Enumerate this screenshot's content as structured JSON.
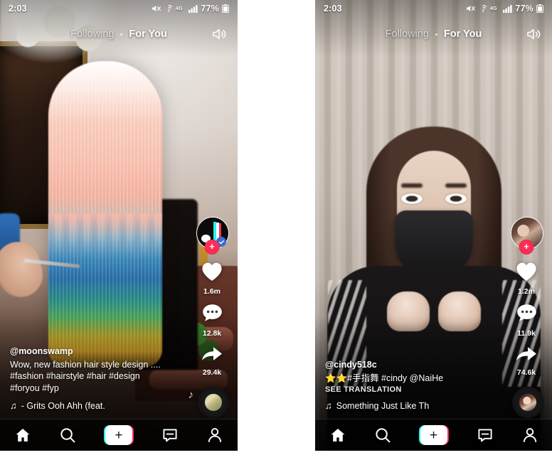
{
  "app": {
    "name": "TikTok"
  },
  "panels": [
    {
      "id": "left",
      "status": {
        "time": "2:03",
        "battery_pct": "77%",
        "icons": [
          "mute-icon",
          "wifi-icon",
          "lte-icon",
          "signal-icon",
          "battery-icon"
        ]
      },
      "topnav": {
        "following": "Following",
        "for_you": "For You",
        "active": "For You",
        "sound_icon": "sound-on-icon"
      },
      "rail": {
        "avatar_type": "tiktok-logo",
        "follow_label": "+",
        "like_count": "1.6m",
        "comment_count": "12.8k",
        "share_count": "29.4k"
      },
      "caption": {
        "username": "@moonswamp",
        "description": "Wow, new fashion hair style design ....",
        "hashtags_line1": "#fashion #hairstyle #hair #design",
        "hashtags_line2": "#foryou #fyp",
        "translation_label": "",
        "music_note": "♫",
        "music_text": "- Grits   Ooh Ahh (feat."
      },
      "bottomnav": {
        "home": "home-icon",
        "discover": "search-icon",
        "create": "+",
        "inbox": "inbox-icon",
        "profile": "profile-icon"
      }
    },
    {
      "id": "right",
      "status": {
        "time": "2:03",
        "battery_pct": "77%",
        "icons": [
          "mute-icon",
          "wifi-icon",
          "lte-icon",
          "signal-icon",
          "battery-icon"
        ]
      },
      "topnav": {
        "following": "Following",
        "for_you": "For You",
        "active": "For You",
        "sound_icon": "sound-on-icon"
      },
      "rail": {
        "avatar_type": "user-photo",
        "follow_label": "+",
        "like_count": "1.2m",
        "comment_count": "11.9k",
        "share_count": "74.6k"
      },
      "caption": {
        "username": "@cindy518c",
        "description": "⭐⭐#手指舞 #cindy @NaiHe",
        "hashtags_line1": "",
        "hashtags_line2": "",
        "translation_label": "SEE TRANSLATION",
        "music_note": "♫",
        "music_text": "Something Just Like Th"
      },
      "bottomnav": {
        "home": "home-icon",
        "discover": "search-icon",
        "create": "+",
        "inbox": "inbox-icon",
        "profile": "profile-icon"
      }
    }
  ],
  "colors": {
    "accent_red": "#fe2c55",
    "accent_cyan": "#25f4ee",
    "text_white": "#ffffff",
    "page_bg": "#ffffff"
  }
}
